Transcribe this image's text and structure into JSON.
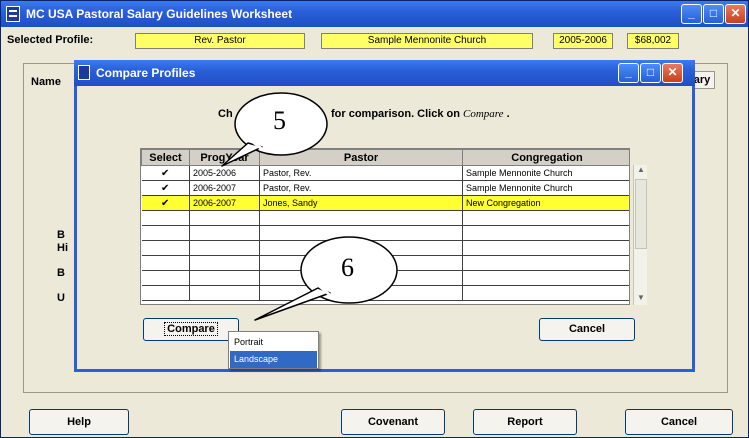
{
  "main": {
    "title": "MC USA Pastoral Salary Guidelines Worksheet",
    "profile_label": "Selected Profile:",
    "profile_pastor": "Rev. Pastor",
    "profile_church": "Sample Mennonite Church",
    "profile_year": "2005-2006",
    "profile_amount": "$68,002",
    "tab_partial_left": "Name",
    "tab_partial_right": "mary",
    "side_labels": [
      "B",
      "Hi",
      "B",
      "U"
    ],
    "buttons": {
      "help": "Help",
      "covenant": "Covenant",
      "report": "Report",
      "cancel": "Cancel"
    }
  },
  "dialog": {
    "title": "Compare Profiles",
    "instruction_prefix": "Ch",
    "instruction_suffix": "for comparison.  Click on",
    "instruction_keyword": "Compare",
    "instruction_end": ".",
    "columns": [
      "Select",
      "ProgYear",
      "Pastor",
      "Congregation"
    ],
    "rows": [
      {
        "select": "✔",
        "year": "2005-2006",
        "pastor": "Pastor, Rev.",
        "congregation": "Sample Mennonite Church",
        "highlight": false
      },
      {
        "select": "✔",
        "year": "2006-2007",
        "pastor": "Pastor, Rev.",
        "congregation": "Sample Mennonite Church",
        "highlight": false
      },
      {
        "select": "✔",
        "year": "2006-2007",
        "pastor": "Jones, Sandy",
        "congregation": "New Congregation",
        "highlight": true
      },
      {
        "select": "",
        "year": "",
        "pastor": "",
        "congregation": "",
        "highlight": false
      },
      {
        "select": "",
        "year": "",
        "pastor": "",
        "congregation": "",
        "highlight": false
      },
      {
        "select": "",
        "year": "",
        "pastor": "",
        "congregation": "",
        "highlight": false
      },
      {
        "select": "",
        "year": "",
        "pastor": "",
        "congregation": "",
        "highlight": false
      },
      {
        "select": "",
        "year": "",
        "pastor": "",
        "congregation": "",
        "highlight": false
      },
      {
        "select": "",
        "year": "",
        "pastor": "",
        "congregation": "",
        "highlight": false
      }
    ],
    "compare_label": "Compare",
    "cancel_label": "Cancel",
    "menu_items": [
      "Portrait",
      "Landscape"
    ]
  },
  "callouts": [
    "5",
    "6"
  ],
  "colors": {
    "titlebar": "#2a5fd9",
    "highlight_row": "#ffff33",
    "field_yellow": "#ffff66",
    "menu_selected": "#316ac5"
  }
}
